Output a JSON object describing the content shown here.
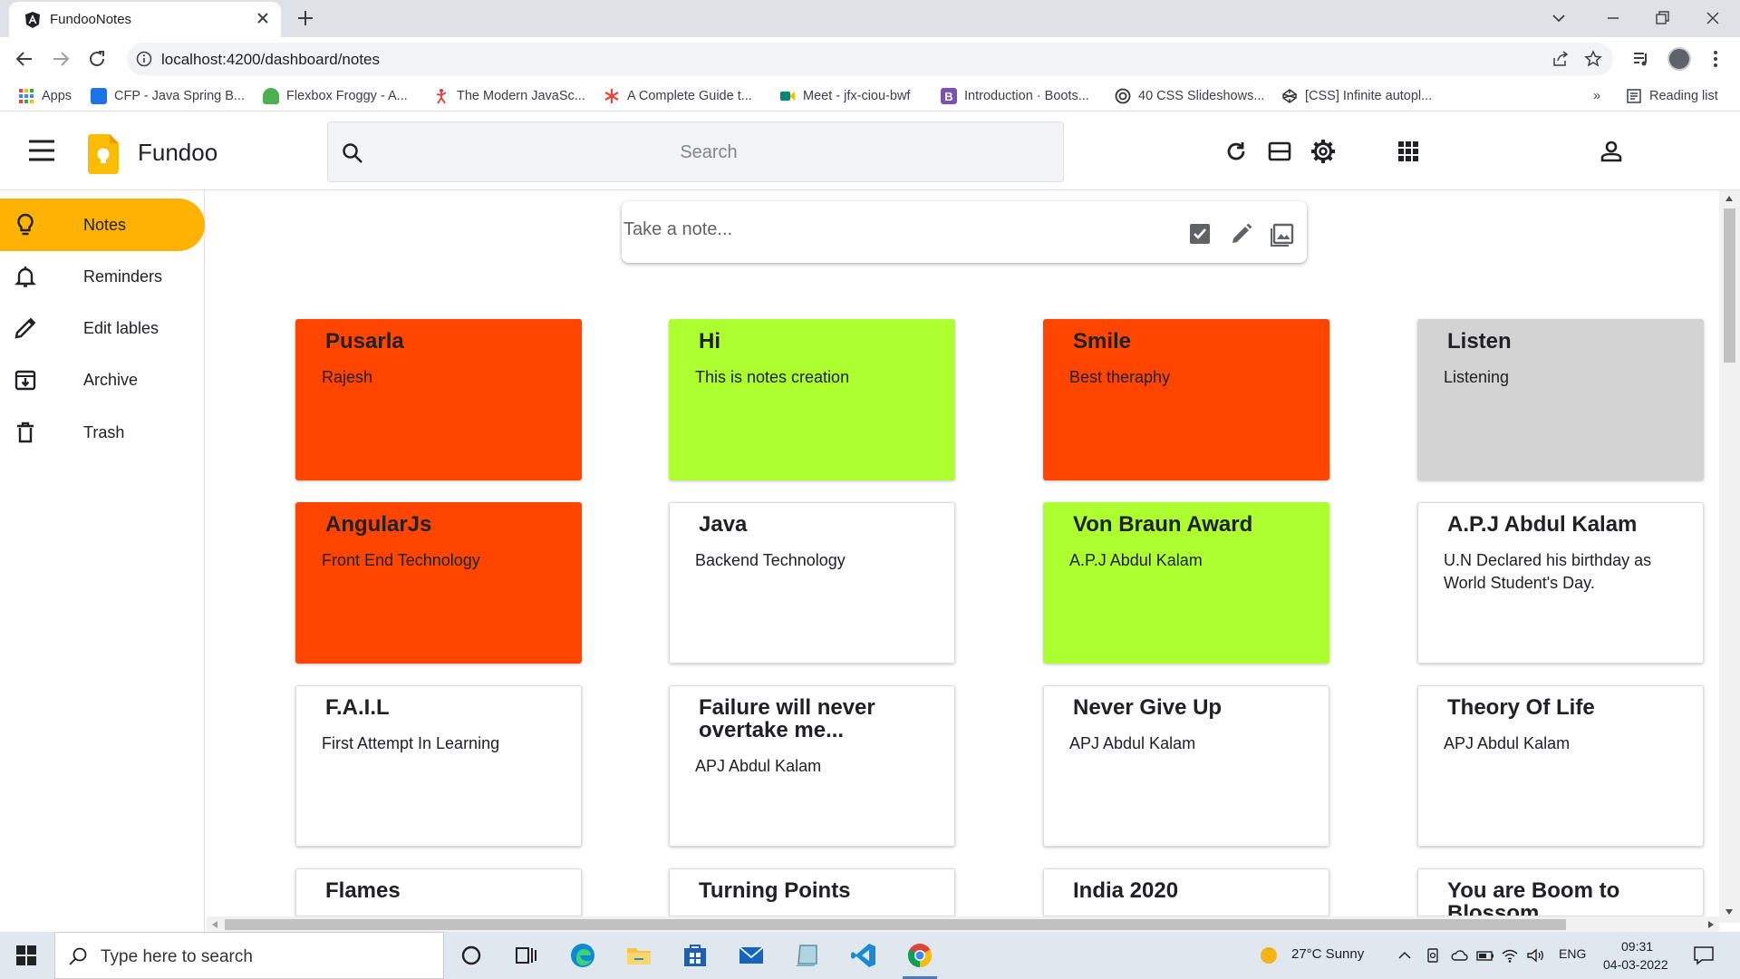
{
  "browser": {
    "tab_title": "FundooNotes",
    "url": "localhost:4200/dashboard/notes",
    "bookmarks": [
      {
        "label": "Apps",
        "color": "#ea4335"
      },
      {
        "label": "CFP - Java Spring B...",
        "color": "#1a73e8"
      },
      {
        "label": "Flexbox Froggy - A...",
        "color": "#4caf50"
      },
      {
        "label": "The Modern JavaSc...",
        "color": "#e53935"
      },
      {
        "label": "A Complete Guide t...",
        "color": "#e8453c"
      },
      {
        "label": "Meet - jfx-ciou-bwf",
        "color": "#00897b"
      },
      {
        "label": "Introduction · Boots...",
        "color": "#7952b3"
      },
      {
        "label": "40 CSS Slideshows...",
        "color": "#333333"
      },
      {
        "label": "[CSS] Infinite autopl...",
        "color": "#333333"
      }
    ],
    "more_bookmarks": "»",
    "reading_list": "Reading list"
  },
  "app": {
    "title": "Fundoo",
    "search_placeholder": "Search",
    "accent": "#feb302"
  },
  "sidebar": {
    "items": [
      {
        "label": "Notes",
        "icon": "bulb-icon",
        "active": true
      },
      {
        "label": "Reminders",
        "icon": "bell-icon",
        "active": false
      },
      {
        "label": "Edit lables",
        "icon": "pencil-icon",
        "active": false
      },
      {
        "label": "Archive",
        "icon": "archive-icon",
        "active": false
      },
      {
        "label": "Trash",
        "icon": "trash-icon",
        "active": false
      }
    ]
  },
  "take_note": {
    "placeholder": "Take a note..."
  },
  "notes": [
    {
      "title": "Pusarla",
      "body": "Rajesh",
      "color": "#ff4500"
    },
    {
      "title": "Hi",
      "body": "This is notes creation",
      "color": "#adff2f"
    },
    {
      "title": "Smile",
      "body": "Best theraphy",
      "color": "#ff4500"
    },
    {
      "title": "Listen",
      "body": "Listening",
      "color": "#d3d3d3"
    },
    {
      "title": "AngularJs",
      "body": "Front End Technology",
      "color": "#ff4500"
    },
    {
      "title": "Java",
      "body": "Backend Technology",
      "color": "#ffffff"
    },
    {
      "title": "Von Braun Award",
      "body": "A.P.J Abdul Kalam",
      "color": "#adff2f"
    },
    {
      "title": "A.P.J Abdul Kalam",
      "body": "U.N Declared his birthday as World Student's Day.",
      "color": "#ffffff"
    },
    {
      "title": "F.A.I.L",
      "body": "First Attempt In Learning",
      "color": "#ffffff"
    },
    {
      "title": "Failure will never overtake me...",
      "body": "APJ Abdul Kalam",
      "color": "#ffffff"
    },
    {
      "title": "Never Give Up",
      "body": "APJ Abdul Kalam",
      "color": "#ffffff"
    },
    {
      "title": "Theory Of Life",
      "body": "APJ Abdul Kalam",
      "color": "#ffffff"
    },
    {
      "title": "Flames",
      "body": "",
      "color": "#ffffff"
    },
    {
      "title": "Turning Points",
      "body": "",
      "color": "#ffffff"
    },
    {
      "title": "India 2020",
      "body": "",
      "color": "#ffffff"
    },
    {
      "title": "You are Boom to Blossom",
      "body": "",
      "color": "#ffffff"
    }
  ],
  "taskbar": {
    "search_placeholder": "Type here to search",
    "weather": "27°C  Sunny",
    "language": "ENG",
    "time": "09:31",
    "date": "04-03-2022"
  }
}
